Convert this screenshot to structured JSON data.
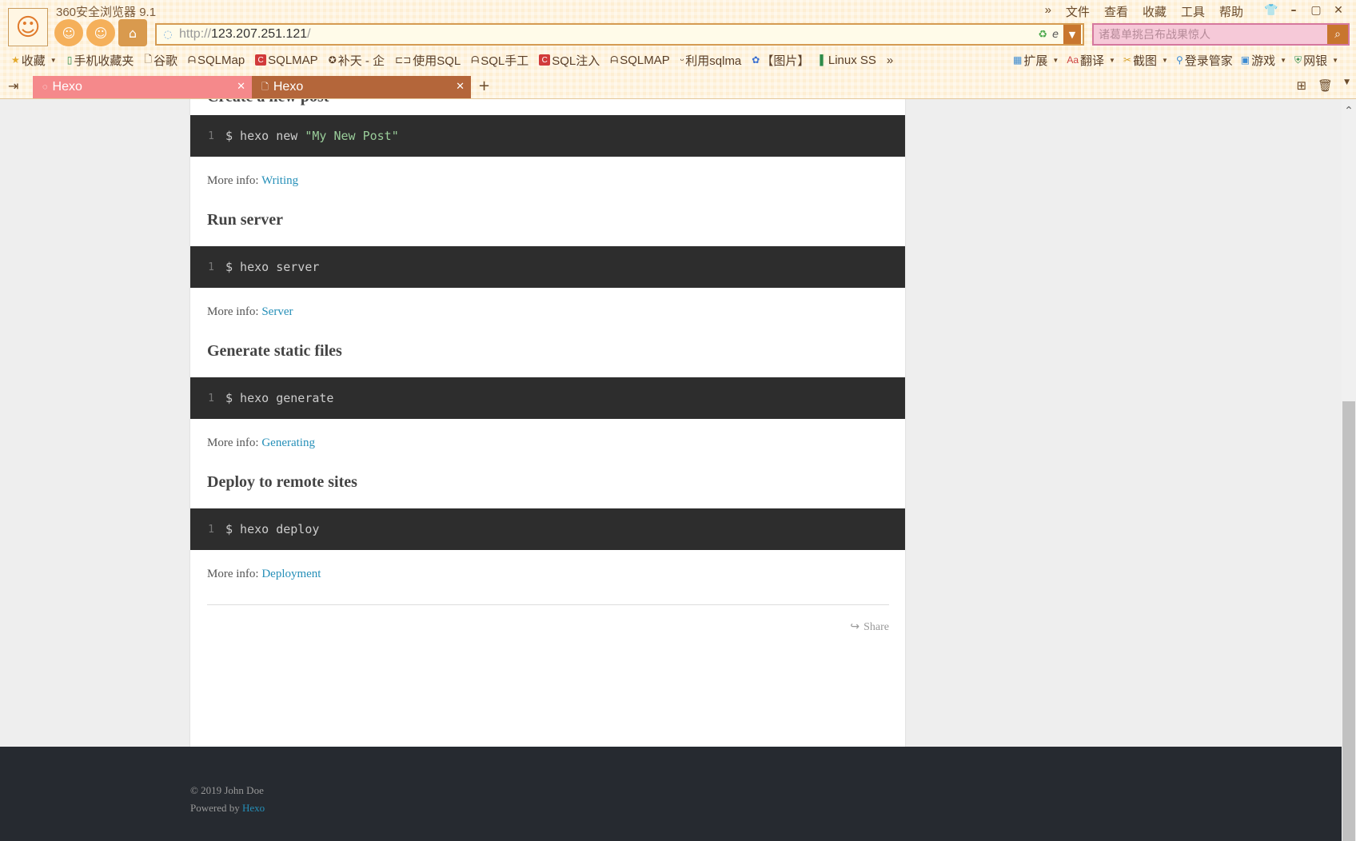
{
  "browser": {
    "title": "360安全浏览器 9.1",
    "menu": [
      "»",
      "文件",
      "查看",
      "收藏",
      "工具",
      "帮助"
    ],
    "url_protocol": "http://",
    "url_host": "123.207.251.121",
    "url_path": "/",
    "search_placeholder": "诸葛单挑吕布战果惊人",
    "bookmarks": [
      {
        "label": "收藏",
        "icon": "star-icon"
      },
      {
        "label": "手机收藏夹",
        "icon": "phone-icon"
      },
      {
        "label": "谷歌",
        "icon": "page-icon"
      },
      {
        "label": "SQLMap",
        "icon": "link-icon"
      },
      {
        "label": "SQLMAP",
        "icon": "c-icon"
      },
      {
        "label": "补天 - 企",
        "icon": "gear-icon"
      },
      {
        "label": "使用SQL",
        "icon": "bracket-icon"
      },
      {
        "label": "SQL手工",
        "icon": "link-icon"
      },
      {
        "label": "SQL注入",
        "icon": "c-icon"
      },
      {
        "label": "SQLMAP",
        "icon": "link-icon"
      },
      {
        "label": "利用sqlma",
        "icon": "link-icon"
      },
      {
        "label": "【图片】",
        "icon": "paw-icon"
      },
      {
        "label": "Linux SS",
        "icon": "bar-icon"
      }
    ],
    "bookmarks_more": "»",
    "tools": [
      {
        "label": "扩展",
        "icon": "grid-icon"
      },
      {
        "label": "翻译",
        "icon": "translate-icon"
      },
      {
        "label": "截图",
        "icon": "scissors-icon"
      },
      {
        "label": "登录管家",
        "icon": "key-icon"
      },
      {
        "label": "游戏",
        "icon": "game-icon"
      },
      {
        "label": "网银",
        "icon": "shield-icon"
      }
    ],
    "tabs": [
      {
        "label": "Hexo",
        "active": false
      },
      {
        "label": "Hexo",
        "active": true
      }
    ]
  },
  "article": {
    "heading_partial": "Create a new post",
    "sections": [
      {
        "heading": "",
        "line_no": "1",
        "cmd": "$ hexo new ",
        "str": "\"My New Post\"",
        "info_prefix": "More info: ",
        "info_link": "Writing"
      },
      {
        "heading": "Run server",
        "line_no": "1",
        "cmd": "$ hexo server",
        "str": "",
        "info_prefix": "More info: ",
        "info_link": "Server"
      },
      {
        "heading": "Generate static files",
        "line_no": "1",
        "cmd": "$ hexo generate",
        "str": "",
        "info_prefix": "More info: ",
        "info_link": "Generating"
      },
      {
        "heading": "Deploy to remote sites",
        "line_no": "1",
        "cmd": "$ hexo deploy",
        "str": "",
        "info_prefix": "More info: ",
        "info_link": "Deployment"
      }
    ],
    "share_label": "Share"
  },
  "footer": {
    "copyright": "© 2019 John Doe",
    "powered_prefix": "Powered by ",
    "powered_link": "Hexo"
  },
  "colors": {
    "chrome_bg": "#fdeed3",
    "tab_inactive": "#f5898b",
    "tab_active": "#b4663a",
    "code_bg": "#2d2d2d",
    "link": "#258fb8",
    "footer_bg": "#262a30"
  }
}
